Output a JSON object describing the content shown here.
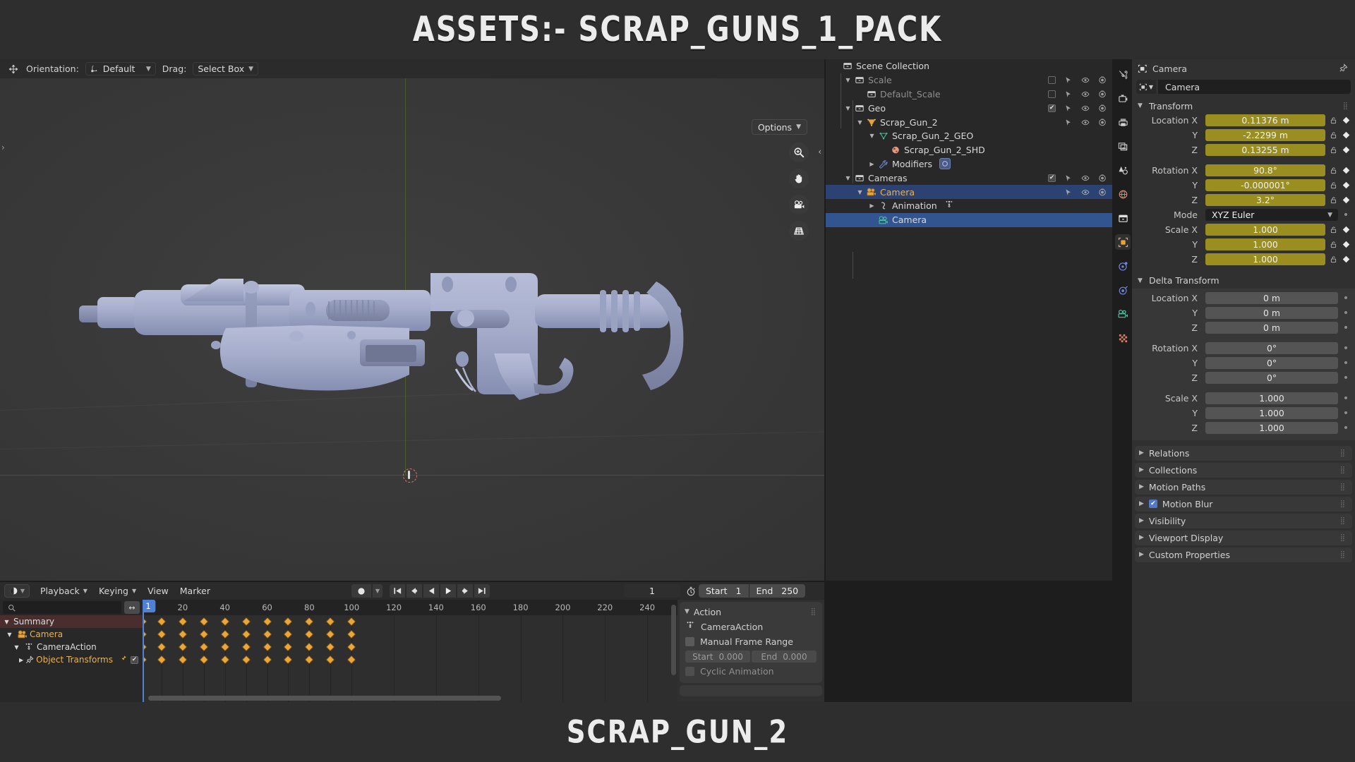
{
  "banner": {
    "top_title": "ASSETS:- SCRAP_GUNS_1_PACK",
    "bottom_title": "SCRAP_GUN_2"
  },
  "viewport": {
    "orientation_label": "Orientation:",
    "orientation_value": "Default",
    "drag_label": "Drag:",
    "drag_value": "Select Box",
    "options_label": "Options",
    "gizmos": [
      "zoom-icon",
      "hand-icon",
      "camera-icon",
      "grid-icon"
    ]
  },
  "outliner": {
    "rows": [
      {
        "name": "Scene Collection",
        "icon": "collection-icon",
        "indent": 0,
        "tri": "",
        "style": "white",
        "toggles": null,
        "state": ""
      },
      {
        "name": "Scale",
        "icon": "collection-icon",
        "indent": 1,
        "tri": "▼",
        "style": "dim",
        "toggles": {
          "check": false,
          "arrow": true,
          "eye": true,
          "cam": true
        },
        "state": ""
      },
      {
        "name": "Default_Scale",
        "icon": "collection-icon",
        "indent": 2,
        "tri": "",
        "style": "dim",
        "toggles": {
          "check": false,
          "arrow": true,
          "eye": true,
          "cam": true
        },
        "state": ""
      },
      {
        "name": "Geo",
        "icon": "collection-icon",
        "indent": 1,
        "tri": "▼",
        "style": "white",
        "toggles": {
          "check": true,
          "arrow": true,
          "eye": true,
          "cam": true
        },
        "state": ""
      },
      {
        "name": "Scrap_Gun_2",
        "icon": "mesh-object-icon",
        "indent": 2,
        "tri": "▼",
        "style": "white",
        "toggles": {
          "check": null,
          "arrow": true,
          "eye": true,
          "cam": true
        },
        "state": ""
      },
      {
        "name": "Scrap_Gun_2_GEO",
        "icon": "mesh-data-icon",
        "indent": 3,
        "tri": "▼",
        "style": "white",
        "toggles": null,
        "state": ""
      },
      {
        "name": "Scrap_Gun_2_SHD",
        "icon": "material-icon",
        "indent": 4,
        "tri": "",
        "style": "white",
        "toggles": null,
        "state": ""
      },
      {
        "name": "Modifiers",
        "icon": "wrench-icon",
        "indent": 3,
        "tri": "▶",
        "style": "white",
        "toggles": null,
        "state": "",
        "badge": "modifier-icon"
      },
      {
        "name": "Cameras",
        "icon": "collection-icon",
        "indent": 1,
        "tri": "▼",
        "style": "white",
        "toggles": {
          "check": true,
          "arrow": true,
          "eye": true,
          "cam": true
        },
        "state": ""
      },
      {
        "name": "Camera",
        "icon": "camera-object-icon",
        "indent": 2,
        "tri": "▼",
        "style": "orange",
        "toggles": {
          "check": null,
          "arrow": true,
          "eye": true,
          "cam": true
        },
        "state": "active"
      },
      {
        "name": "Animation",
        "icon": "animation-icon",
        "indent": 3,
        "tri": "▶",
        "style": "white",
        "toggles": null,
        "state": "",
        "badge2": "action-icon"
      },
      {
        "name": "Camera",
        "icon": "camera-data-icon",
        "indent": 3,
        "tri": "",
        "style": "white",
        "toggles": null,
        "state": "selected"
      }
    ]
  },
  "properties": {
    "breadcrumb": "Camera",
    "id_name": "Camera",
    "transform": {
      "title": "Transform",
      "rows": [
        {
          "label": "Location X",
          "value": "0.11376 m",
          "kind": "anim"
        },
        {
          "label": "Y",
          "value": "-2.2299 m",
          "kind": "anim"
        },
        {
          "label": "Z",
          "value": "0.13255 m",
          "kind": "anim"
        },
        {
          "label": "Rotation X",
          "value": "90.8°",
          "kind": "anim"
        },
        {
          "label": "Y",
          "value": "-0.000001°",
          "kind": "anim"
        },
        {
          "label": "Z",
          "value": "3.2°",
          "kind": "anim"
        }
      ],
      "mode_label": "Mode",
      "mode_value": "XYZ Euler",
      "scale_rows": [
        {
          "label": "Scale X",
          "value": "1.000",
          "kind": "anim"
        },
        {
          "label": "Y",
          "value": "1.000",
          "kind": "anim"
        },
        {
          "label": "Z",
          "value": "1.000",
          "kind": "anim"
        }
      ]
    },
    "delta": {
      "title": "Delta Transform",
      "rows": [
        {
          "label": "Location X",
          "value": "0 m"
        },
        {
          "label": "Y",
          "value": "0 m"
        },
        {
          "label": "Z",
          "value": "0 m"
        },
        {
          "label": "Rotation X",
          "value": "0°"
        },
        {
          "label": "Y",
          "value": "0°"
        },
        {
          "label": "Z",
          "value": "0°"
        },
        {
          "label": "Scale X",
          "value": "1.000"
        },
        {
          "label": "Y",
          "value": "1.000"
        },
        {
          "label": "Z",
          "value": "1.000"
        }
      ]
    },
    "closed_sections": [
      {
        "label": "Relations",
        "checkbox": false
      },
      {
        "label": "Collections",
        "checkbox": false
      },
      {
        "label": "Motion Paths",
        "checkbox": false
      },
      {
        "label": "Motion Blur",
        "checkbox": true
      },
      {
        "label": "Visibility",
        "checkbox": false
      },
      {
        "label": "Viewport Display",
        "checkbox": false
      },
      {
        "label": "Custom Properties",
        "checkbox": false
      }
    ],
    "tabs": [
      "tool-icon",
      "render-icon",
      "output-icon",
      "view-layer-icon",
      "scene-icon",
      "world-icon",
      "collection-icon",
      "object-icon",
      "modifier-icon",
      "physics-icon",
      "object-data-camera-icon",
      "texture-icon"
    ],
    "active_tab_index": 7
  },
  "dopesheet": {
    "menus": [
      "Playback",
      "Keying",
      "View",
      "Marker"
    ],
    "search_placeholder": "",
    "current_frame": "1",
    "start_label": "Start",
    "start_value": "1",
    "end_label": "End",
    "end_value": "250",
    "channels": [
      {
        "label": "Summary",
        "type": "summary"
      },
      {
        "label": "Camera",
        "type": "object"
      },
      {
        "label": "CameraAction",
        "type": "action"
      },
      {
        "label": "Object Transforms",
        "type": "group"
      }
    ],
    "ruler_ticks": [
      20,
      40,
      60,
      80,
      100,
      120,
      140,
      160,
      180,
      200,
      220,
      240
    ],
    "keyframes": [
      1,
      10,
      20,
      30,
      40,
      50,
      60,
      70,
      80,
      90,
      100
    ],
    "frame_range_view": [
      1,
      255
    ],
    "action": {
      "title": "Action",
      "action_name": "CameraAction",
      "manual_frame_range": "Manual Frame Range",
      "start_label": "Start",
      "start_value": "0.000",
      "end_label": "End",
      "end_value": "0.000",
      "cyclic_label": "Cyclic Animation"
    }
  },
  "colors": {
    "accent_blue": "#33558f",
    "anim_yellow": "#9a8e20",
    "keyframe": "#eba63a",
    "playhead": "#4f82d6",
    "background": "#2e2e2e"
  }
}
